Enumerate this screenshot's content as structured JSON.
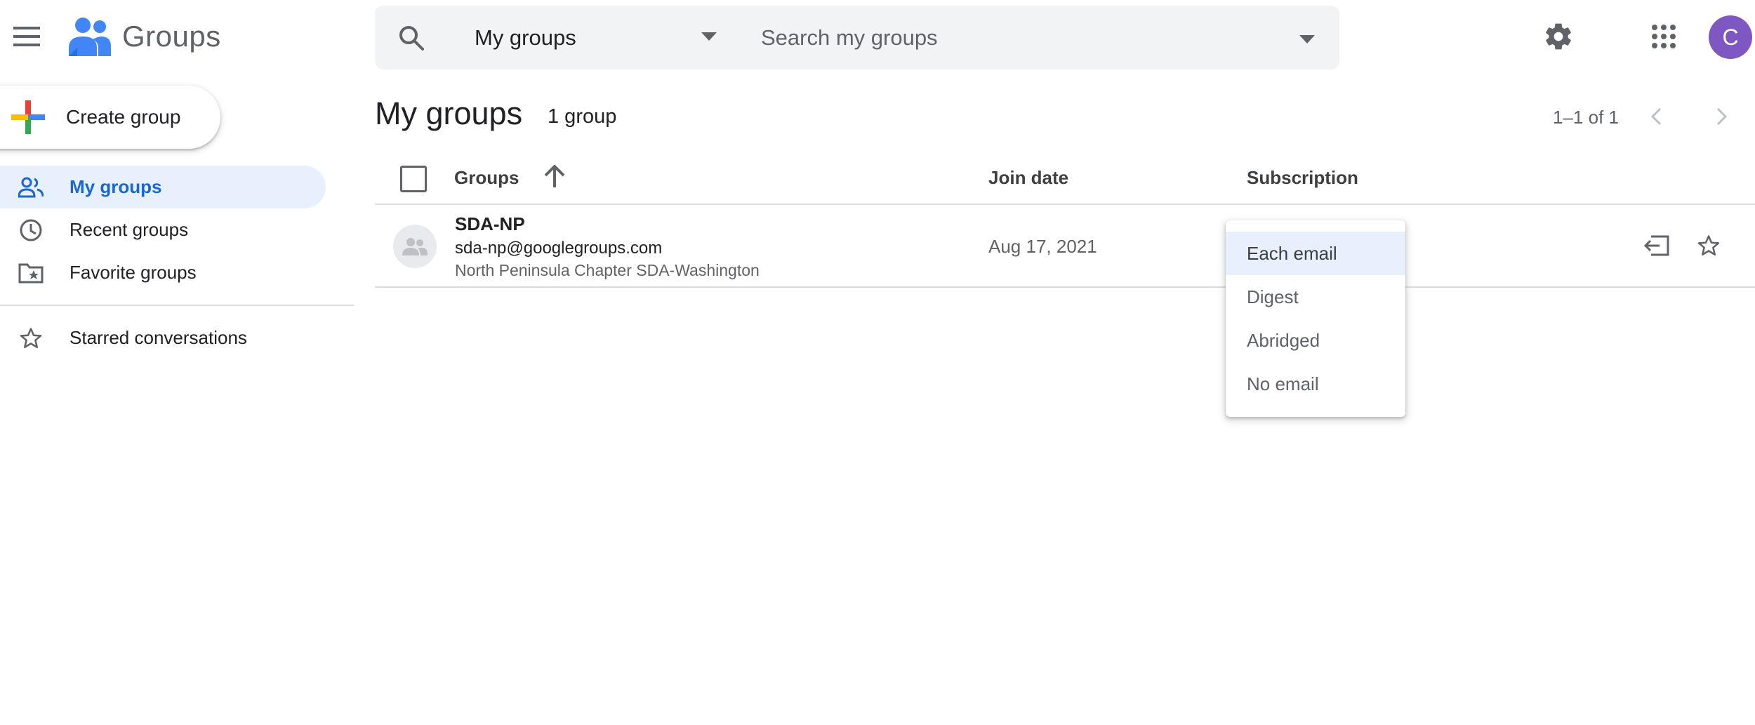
{
  "app": {
    "name": "Groups",
    "brand_color": "#4285f4"
  },
  "header": {
    "search_scope": "My groups",
    "search_placeholder": "Search my groups",
    "account_initial": "C",
    "account_color": "#7e57c2"
  },
  "sidebar": {
    "create_label": "Create group",
    "items": [
      {
        "label": "My groups",
        "icon": "people-icon",
        "active": true
      },
      {
        "label": "Recent groups",
        "icon": "clock-icon",
        "active": false
      },
      {
        "label": "Favorite groups",
        "icon": "folder-star-icon",
        "active": false
      },
      {
        "label": "Starred conversations",
        "icon": "star-outline-icon",
        "active": false
      }
    ]
  },
  "main": {
    "title": "My groups",
    "count": "1 group",
    "pagination": "1–1 of 1",
    "columns": {
      "groups": "Groups",
      "join_date": "Join date",
      "subscription": "Subscription"
    },
    "rows": [
      {
        "name": "SDA-NP",
        "email": "sda-np@googlegroups.com",
        "description": "North Peninsula Chapter SDA-Washington",
        "join_date": "Aug 17, 2021"
      }
    ]
  },
  "subscription_menu": {
    "selected": "Each email",
    "options": [
      "Each email",
      "Digest",
      "Abridged",
      "No email"
    ]
  },
  "colors": {
    "active_bg": "#e8f0fe",
    "active_text": "#1967d2",
    "text_secondary": "#5f6368",
    "divider": "#dadce0"
  }
}
